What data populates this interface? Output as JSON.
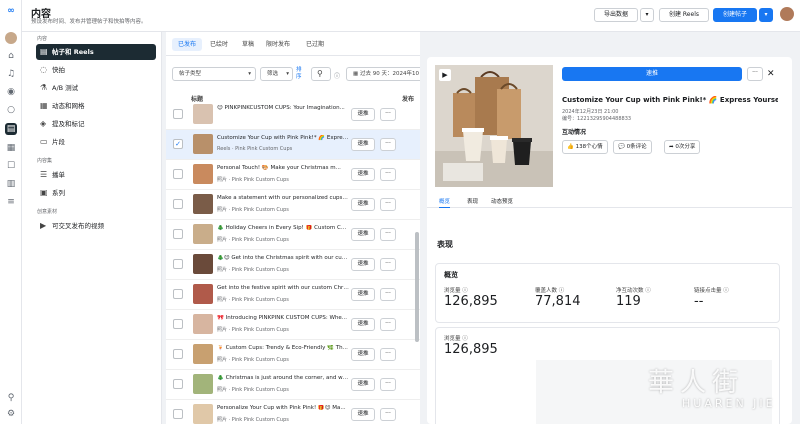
{
  "header": {
    "title": "内容",
    "subtitle": "预设发布时间、发布并管理帖子和快拍等内容。",
    "export_label": "导出数据",
    "create_reels_label": "创建 Reels",
    "create_post_label": "创建帖子"
  },
  "sidebar": {
    "section1": "内容",
    "section2": "内容集",
    "section3": "创意素材",
    "items": [
      {
        "label": "帖子和 Reels",
        "icon": "posts-icon"
      },
      {
        "label": "快拍",
        "icon": "stories-icon"
      },
      {
        "label": "A/B 测试",
        "icon": "ab-test-icon"
      },
      {
        "label": "动态和网格",
        "icon": "grid-icon"
      },
      {
        "label": "提及和标记",
        "icon": "mention-icon"
      },
      {
        "label": "片段",
        "icon": "clips-icon"
      },
      {
        "label": "播单",
        "icon": "playlist-icon"
      },
      {
        "label": "系列",
        "icon": "series-icon"
      },
      {
        "label": "可交叉发布的视频",
        "icon": "crosspost-icon"
      }
    ]
  },
  "tabs": [
    "已发布",
    "已绘时",
    "草稿",
    "限时发布",
    "已过期"
  ],
  "filters": {
    "post_type": "帖子类型",
    "filter": "筛选",
    "sort": "排序",
    "date_range": "过去 90 天：2024年10"
  },
  "columns": {
    "title": "标题",
    "publish": "发布"
  },
  "rows": [
    {
      "title": "😊 PINKPINKCUSTOM CUPS: Your Imagination...",
      "meta": "",
      "action": "速推",
      "selected": false
    },
    {
      "title": "Customize Your Cup with Pink Pink!* 🌈 Expres...",
      "meta": "Reels · Pink Pink Custom Cups",
      "action": "速推",
      "selected": true
    },
    {
      "title": "Personal Touch! 🎨 Make your Christmas m...",
      "meta": "照片 · Pink Pink Custom Cups",
      "action": "速推",
      "selected": false
    },
    {
      "title": "Make a statement with our personalized cups t...",
      "meta": "照片 · Pink Pink Custom Cups",
      "action": "速推",
      "selected": false
    },
    {
      "title": "🎄 Holiday Cheers in Every Sip! 🎁 Custom Chri...",
      "meta": "照片 · Pink Pink Custom Cups",
      "action": "速推",
      "selected": false
    },
    {
      "title": "🎄😊 Get into the Christmas spirit with our cus...",
      "meta": "照片 · Pink Pink Custom Cups",
      "action": "速推",
      "selected": false
    },
    {
      "title": "Get into the festive spirit with our custom Chris...",
      "meta": "照片 · Pink Pink Custom Cups",
      "action": "速推",
      "selected": false
    },
    {
      "title": "🎀 Introducing PINKPINK CUSTOM CUPS: Whe...",
      "meta": "照片 · Pink Pink Custom Cups",
      "action": "速推",
      "selected": false
    },
    {
      "title": "🍹 Custom Cups: Trendy & Eco-Friendly 🌿 Th...",
      "meta": "照片 · Pink Pink Custom Cups",
      "action": "速推",
      "selected": false
    },
    {
      "title": "🎄 Christmas is just around the corner, and whe...",
      "meta": "照片 · Pink Pink Custom Cups",
      "action": "速推",
      "selected": false
    },
    {
      "title": "Personalize Your Cup with Pink Pink! 🎁😊 Ma...",
      "meta": "照片 · Pink Pink Custom Cups",
      "action": "速推",
      "selected": false
    }
  ],
  "detail": {
    "boost_label": "速推",
    "title": "Customize Your Cup with Pink Pink!* 🌈 Express Yourself ...",
    "date": "2024年12月23日 21:00",
    "id": "编号：12213295904488833",
    "interactions_label": "互动情况",
    "likes": "138个心情",
    "comments": "0条评论",
    "shares": "0次分享",
    "tabs": [
      "概览",
      "表现",
      "动态预览"
    ],
    "performance_heading": "表现",
    "overview_heading": "概览",
    "metrics": [
      {
        "label": "浏览量",
        "value": "126,895"
      },
      {
        "label": "覆盖人数",
        "value": "77,814"
      },
      {
        "label": "净互动次数",
        "value": "119"
      },
      {
        "label": "链接点击量",
        "value": "--"
      }
    ],
    "views_label": "浏览量",
    "views_value": "126,895"
  },
  "watermark": {
    "line1": "華人街",
    "line2": "HUAREN JIE"
  }
}
